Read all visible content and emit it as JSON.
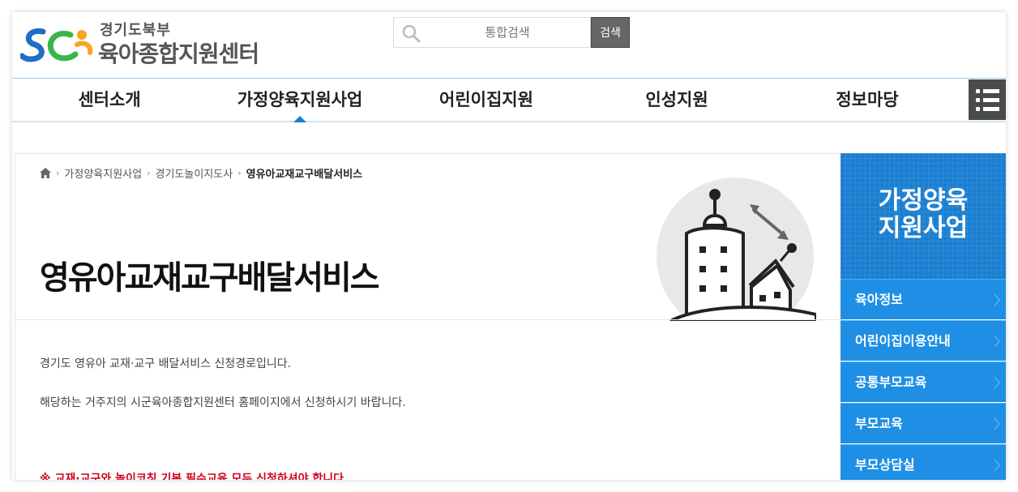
{
  "header": {
    "logo_sub": "경기도북부",
    "logo_main": "육아종합지원센터",
    "search_placeholder": "통합검색",
    "search_button": "검색"
  },
  "nav": {
    "items": [
      {
        "label": "센터소개"
      },
      {
        "label": "가정양육지원사업",
        "active": true
      },
      {
        "label": "어린이집지원"
      },
      {
        "label": "인성지원"
      },
      {
        "label": "정보마당"
      }
    ]
  },
  "breadcrumb": {
    "items": [
      "가정양육지원사업",
      "경기도놀이지도사"
    ],
    "current": "영유아교재교구배달서비스"
  },
  "page": {
    "title": "영유아교재교구배달서비스",
    "paragraphs": [
      "경기도 영유아 교재·교구 배달서비스 신청경로입니다.",
      "해당하는 거주지의 시군육아종합지원센터 홈페이지에서 신청하시기 바랍니다."
    ],
    "notice": "※ 교재·교구와 놀이코칭 기본 필수교육 모두 신청하셔야 합니다."
  },
  "sidebar": {
    "title_line1": "가정양육",
    "title_line2": "지원사업",
    "items": [
      "육아정보",
      "어린이집이용안내",
      "공통부모교육",
      "부모교육",
      "부모상담실"
    ]
  },
  "colors": {
    "accent": "#1a7fd0",
    "sidebar_item": "#1e8fe4",
    "notice": "#d0021b",
    "menu_button": "#4a4a4a"
  }
}
